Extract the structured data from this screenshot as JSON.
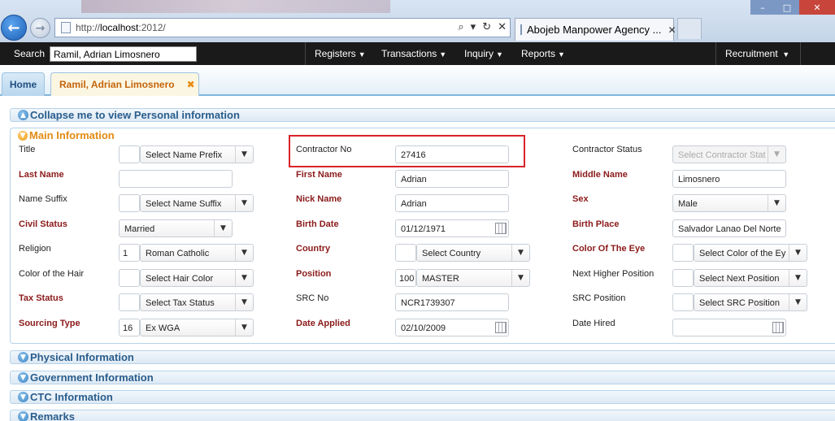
{
  "browser": {
    "url_prefix": "http://",
    "url_host": "localhost",
    "url_rest": ":2012/",
    "tab_title": "Abojeb Manpower Agency ...",
    "tab_close": "✕"
  },
  "menubar": {
    "search_label": "Search",
    "search_value": "Ramil, Adrian Limosnero",
    "items": [
      "Registers",
      "Transactions",
      "Inquiry",
      "Reports",
      "Recruitment"
    ]
  },
  "tabs": {
    "home": "Home",
    "current": "Ramil, Adrian Limosnero",
    "close": "✖"
  },
  "panels": {
    "collapse_personal": "Collapse me to view Personal information",
    "main": "Main Information",
    "physical": "Physical Information",
    "government": "Government Information",
    "ctc": "CTC Information",
    "remarks": "Remarks"
  },
  "fields": {
    "title": {
      "label": "Title",
      "prefix": "",
      "select": "Select Name Prefix"
    },
    "contractor_no": {
      "label": "Contractor No",
      "value": "27416"
    },
    "contractor_status": {
      "label": "Contractor Status",
      "select": "Select Contractor Stat"
    },
    "last_name": {
      "label": "Last Name",
      "value": ""
    },
    "first_name": {
      "label": "First Name",
      "value": "Adrian"
    },
    "middle_name": {
      "label": "Middle Name",
      "value": "Limosnero"
    },
    "name_suffix": {
      "label": "Name Suffix",
      "prefix": "",
      "select": "Select Name Suffix"
    },
    "nick_name": {
      "label": "Nick Name",
      "value": "Adrian"
    },
    "sex": {
      "label": "Sex",
      "select": "Male"
    },
    "civil_status": {
      "label": "Civil Status",
      "select": "Married"
    },
    "birth_date": {
      "label": "Birth Date",
      "value": "01/12/1971"
    },
    "birth_place": {
      "label": "Birth Place",
      "value": "Salvador Lanao Del Norte"
    },
    "religion": {
      "label": "Religion",
      "code": "1",
      "select": "Roman Catholic"
    },
    "country": {
      "label": "Country",
      "code": "",
      "select": "Select Country"
    },
    "eye_color": {
      "label": "Color Of The Eye",
      "code": "",
      "select": "Select Color of the Ey"
    },
    "hair_color": {
      "label": "Color of the Hair",
      "code": "",
      "select": "Select Hair Color"
    },
    "position": {
      "label": "Position",
      "code": "100",
      "select": "MASTER"
    },
    "next_position": {
      "label": "Next Higher Position",
      "code": "",
      "select": "Select Next Position"
    },
    "tax_status": {
      "label": "Tax Status",
      "code": "",
      "select": "Select Tax Status"
    },
    "src_no": {
      "label": "SRC No",
      "value": "NCR1739307"
    },
    "src_position": {
      "label": "SRC Position",
      "code": "",
      "select": "Select SRC Position"
    },
    "sourcing_type": {
      "label": "Sourcing Type",
      "code": "16",
      "select": "Ex WGA"
    },
    "date_applied": {
      "label": "Date Applied",
      "value": "02/10/2009"
    },
    "date_hired": {
      "label": "Date Hired",
      "value": ""
    }
  }
}
